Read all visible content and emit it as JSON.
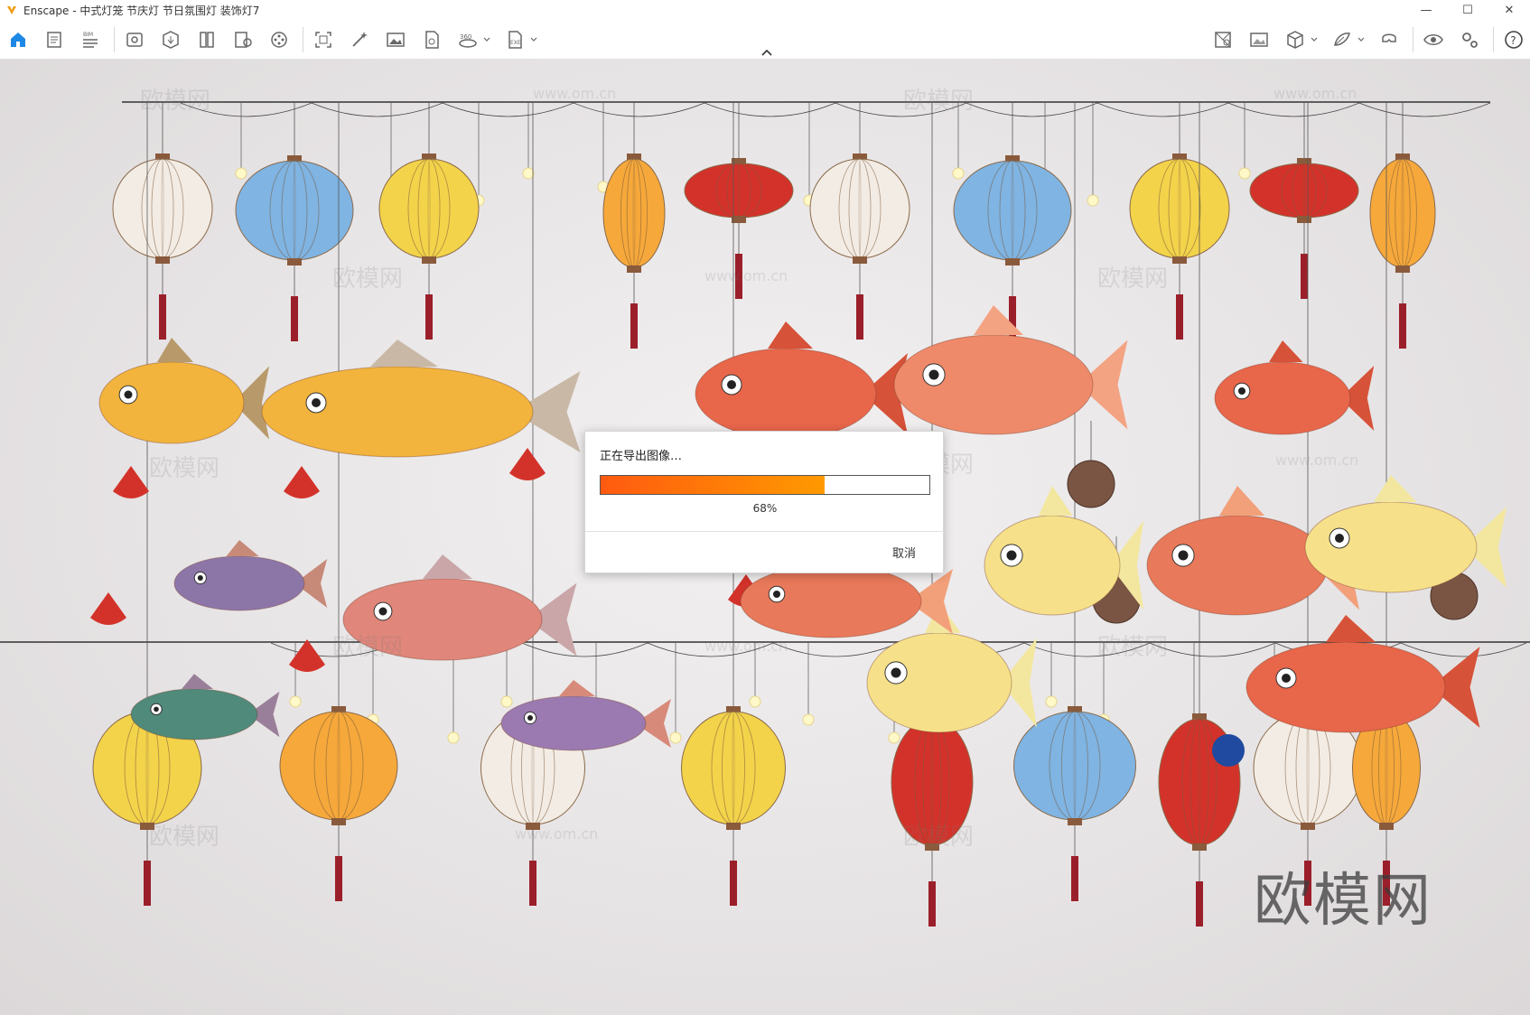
{
  "window": {
    "title": "Enscape - 中式灯笼 节庆灯 节日氛围灯 装饰灯7",
    "minimize_glyph": "—",
    "maximize_glyph": "☐",
    "close_glyph": "✕"
  },
  "toolbar": {
    "left_icons": [
      "home-icon",
      "document-icon",
      "bim-icon",
      "view-icon",
      "asset-icon",
      "library-icon",
      "settings-doc-icon",
      "video-reel-icon",
      "screenshot-icon",
      "magic-wand-icon",
      "image-icon",
      "batch-render-icon",
      "panorama-360-icon",
      "exe-export-icon"
    ],
    "right_icons": [
      "map-icon",
      "image-settings-icon",
      "cube-icon",
      "material-icon",
      "vr-headset-icon",
      "visual-settings-icon",
      "gear-settings-icon",
      "help-icon"
    ],
    "accent": "#1e88e5"
  },
  "watermarks": {
    "small": "欧模网",
    "url": "www.om.cn",
    "big": "欧模网"
  },
  "dialog": {
    "message": "正在导出图像…",
    "progress_percent": 68,
    "progress_label": "68%",
    "cancel_label": "取消",
    "fill_colors": [
      "#ff5a10",
      "#ff9a00"
    ]
  },
  "scene_colors": {
    "white_lantern": "#f3ece4",
    "blue_lantern": "#7fb4e3",
    "yellow_lantern": "#f3d34a",
    "orange_lantern": "#f6a83a",
    "red_lantern": "#d3322a",
    "koi_orange": "#e8664a",
    "koi_yellow": "#f6e18a",
    "brown_ball": "#7a5544",
    "tassel": "#9b1f2a"
  }
}
